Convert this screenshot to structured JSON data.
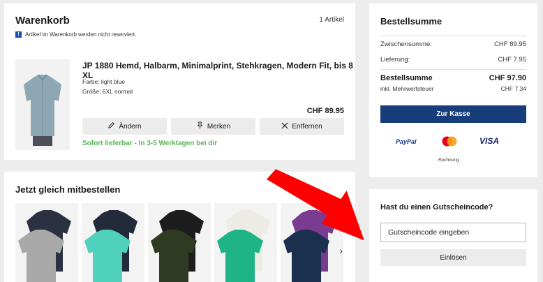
{
  "cart": {
    "title": "Warenkorb",
    "count": "1 Artikel",
    "notice": "Artikel im Warenkorb werden nicht reserviert.",
    "item": {
      "name": "JP 1880 Hemd, Halbarm, Minimalprint, Stehkragen, Modern Fit, bis 8 XL",
      "color": "Farbe: light blue",
      "size": "Größe: 6XL normal",
      "price": "CHF 89.95",
      "edit": "Ändern",
      "remember": "Merken",
      "remove": "Entfernen",
      "availability": "Sofort lieferbar - In 3-5 Werktagen bei dir"
    }
  },
  "recommendations": {
    "title": "Jetzt gleich mitbestellen",
    "items": [
      {
        "name": "navy-grey-polo-2pack",
        "colors": [
          "#2b3142",
          "#a9a9a9"
        ]
      },
      {
        "name": "navy-turquoise-tshirt-2pack",
        "colors": [
          "#222a3c",
          "#4fd1bd"
        ]
      },
      {
        "name": "black-olive-polo-2pack",
        "colors": [
          "#1d1d1d",
          "#2f3a22"
        ]
      },
      {
        "name": "white-green-polo-2pack",
        "colors": [
          "#ecebe4",
          "#1fb486"
        ]
      },
      {
        "name": "purple-navy-polo-2pack",
        "colors": [
          "#7a3c90",
          "#1b2f4f"
        ]
      }
    ]
  },
  "summary": {
    "title": "Bestellsumme",
    "subtotal_label": "Zwischensumme:",
    "subtotal_value": "CHF 89.95",
    "delivery_label": "Lieferung:",
    "delivery_value": "CHF 7.95",
    "total_label": "Bestellsumme",
    "total_value": "CHF 97.90",
    "vat_label": "inkl. Mehrwertsteuer",
    "vat_value": "CHF 7.34",
    "checkout": "Zur Kasse",
    "payment": {
      "paypal": "PayPal",
      "visa": "VISA",
      "invoice": "Rechnung"
    }
  },
  "voucher": {
    "title": "Hast du einen Gutscheincode?",
    "placeholder": "Gutscheincode eingeben",
    "redeem": "Einlösen"
  },
  "colors": {
    "accent": "#173d7a",
    "success": "#56b556",
    "annotation": "#ff0000"
  }
}
